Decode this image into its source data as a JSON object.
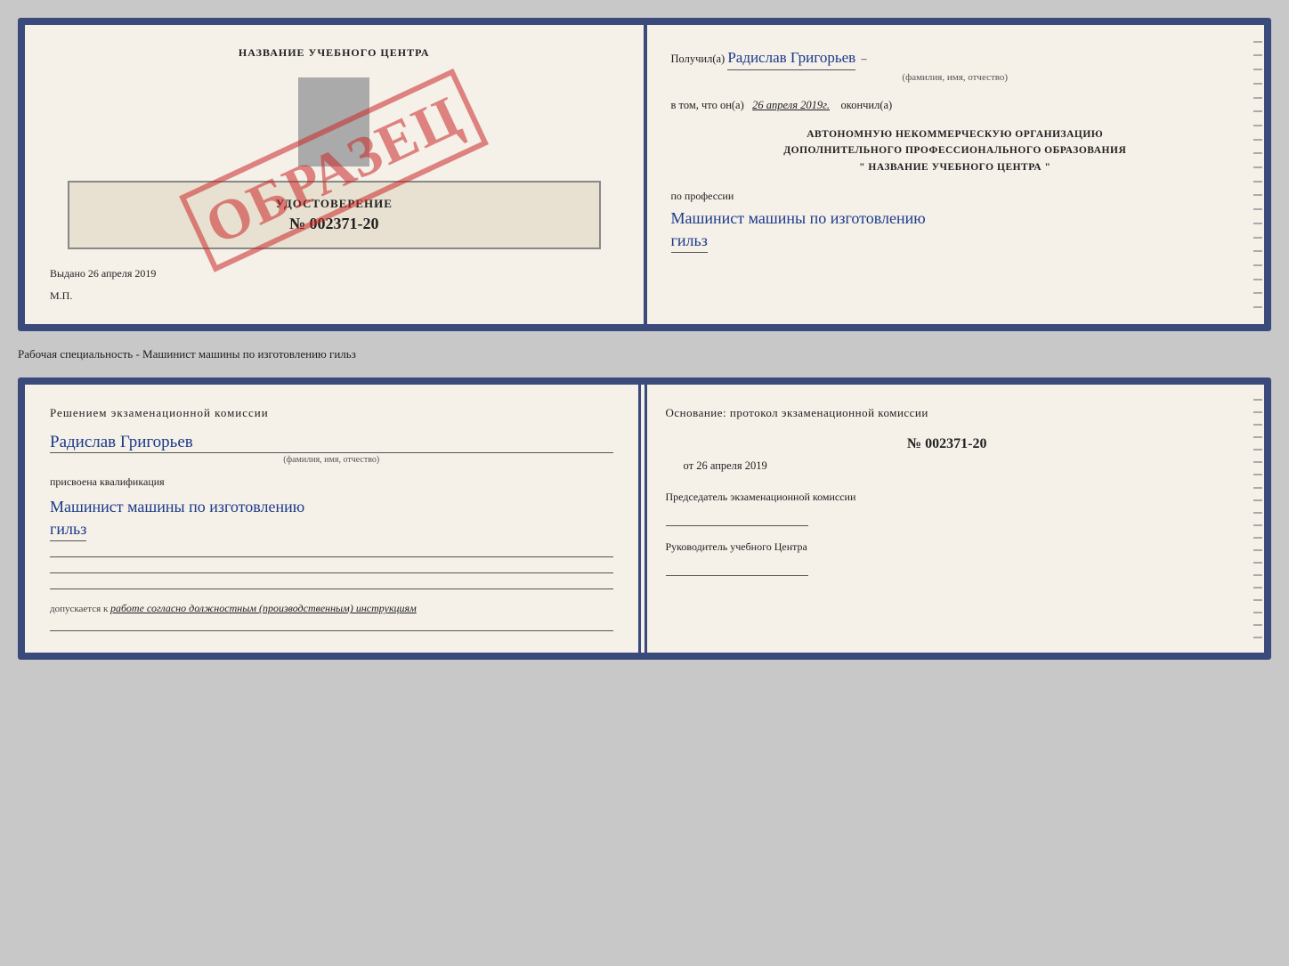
{
  "doc1": {
    "left": {
      "title": "НАЗВАНИЕ УЧЕБНОГО ЦЕНТРА",
      "udost_label": "УДОСТОВЕРЕНИЕ",
      "number": "№ 002371-20",
      "vydano_label": "Выдано",
      "vydano_date": "26 апреля 2019",
      "mp_label": "М.П.",
      "stamp": "ОБРАЗЕЦ"
    },
    "right": {
      "poluchil_label": "Получил(а)",
      "recipient_name": "Радислав Григорьев",
      "recipient_sub": "(фамилия, имя, отчество)",
      "vtom_label": "в том, что он(а)",
      "date_value": "26 апреля 2019г.",
      "okonchil_label": "окончил(а)",
      "org_line1": "АВТОНОМНУЮ НЕКОММЕРЧЕСКУЮ ОРГАНИЗАЦИЮ",
      "org_line2": "ДОПОЛНИТЕЛЬНОГО ПРОФЕССИОНАЛЬНОГО ОБРАЗОВАНИЯ",
      "org_name": "\" НАЗВАНИЕ УЧЕБНОГО ЦЕНТРА \"",
      "po_professii": "по профессии",
      "profession1": "Машинист машины по изготовлению",
      "profession2": "гильз"
    }
  },
  "separator": {
    "text": "Рабочая специальность - Машинист машины по изготовлению гильз"
  },
  "doc2": {
    "left": {
      "decision_title": "Решением  экзаменационной  комиссии",
      "name": "Радислав Григорьев",
      "name_sub": "(фамилия, имя, отчество)",
      "prisvoena": "присвоена квалификация",
      "profession1": "Машинист машины по изготовлению",
      "profession2": "гильз",
      "dopuskaetsya_label": "допускается к",
      "dopuskaetsya_value": "работе согласно должностным (производственным) инструкциям"
    },
    "right": {
      "osnov_title": "Основание: протокол экзаменационной  комиссии",
      "number": "№  002371-20",
      "date_prefix": "от",
      "date_value": "26 апреля 2019",
      "chairman_label": "Председатель экзаменационной комиссии",
      "director_label": "Руководитель учебного Центра"
    }
  }
}
